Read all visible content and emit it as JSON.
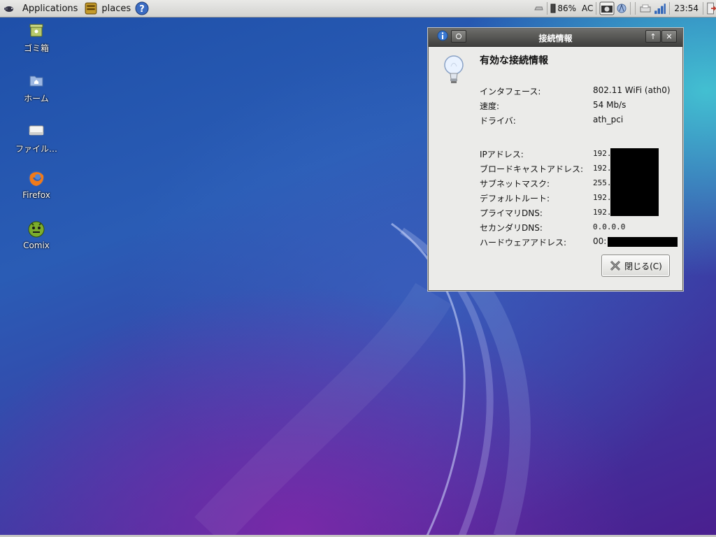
{
  "panel": {
    "applications_label": "Applications",
    "places_label": "places",
    "battery_text": "86%",
    "power_text": "AC",
    "clock": "23:54"
  },
  "desktop": {
    "icons": [
      {
        "label": "ゴミ箱",
        "icon": "trash-icon"
      },
      {
        "label": "ホーム",
        "icon": "home-folder-icon"
      },
      {
        "label": "ファイル…",
        "icon": "drive-icon"
      },
      {
        "label": "Firefox",
        "icon": "firefox-icon"
      },
      {
        "label": "Comix",
        "icon": "comix-icon"
      }
    ]
  },
  "dialog": {
    "title": "接続情報",
    "heading": "有効な接続情報",
    "fields": [
      {
        "label": "インタフェース:",
        "value": "802.11 WiFi (ath0)"
      },
      {
        "label": "速度:",
        "value": "54 Mb/s"
      },
      {
        "label": "ドライバ:",
        "value": "ath_pci"
      },
      {
        "label": "IPアドレス:",
        "value": "192."
      },
      {
        "label": "ブロードキャストアドレス:",
        "value": "192."
      },
      {
        "label": "サブネットマスク:",
        "value": "255."
      },
      {
        "label": "デフォルトルート:",
        "value": "192."
      },
      {
        "label": "プライマリDNS:",
        "value": "192."
      },
      {
        "label": "セカンダリDNS:",
        "value": "0.0.0.0"
      },
      {
        "label": "ハードウェアアドレス:",
        "value": "00:"
      }
    ],
    "close_button": "閉じる(C)"
  },
  "colors": {
    "panel_bg": "#dcdcd9",
    "titlebar": "#4f4f4d",
    "dialog_bg": "#ebebe9"
  }
}
